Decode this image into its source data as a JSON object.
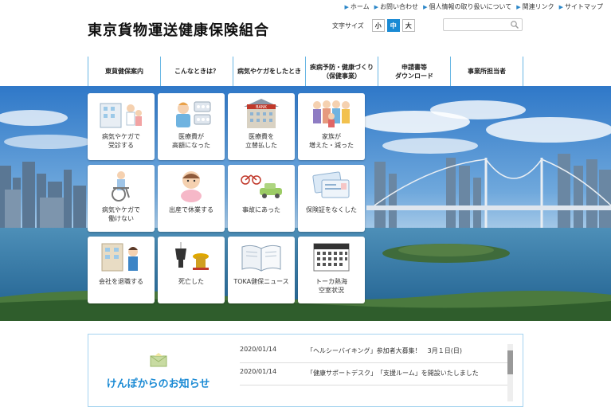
{
  "util_links": [
    {
      "label": "ホーム"
    },
    {
      "label": "お問い合わせ"
    },
    {
      "label": "個人情報の取り扱いについて"
    },
    {
      "label": "関連リンク"
    },
    {
      "label": "サイトマップ"
    }
  ],
  "site_title": "東京貨物運送健康保険組合",
  "font_size": {
    "label": "文字サイズ",
    "small": "小",
    "medium": "中",
    "large": "大",
    "active": "medium"
  },
  "search": {
    "placeholder": ""
  },
  "nav": [
    {
      "label": "東貨健保案内"
    },
    {
      "label": "こんなときは？"
    },
    {
      "label": "病気やケガをしたとき"
    },
    {
      "label": "疾病予防・健康づくり\n（保健事業）"
    },
    {
      "label": "申請書等\nダウンロード"
    },
    {
      "label": "事業所担当者"
    }
  ],
  "tiles": [
    {
      "label": "病気やケガで\n受診する",
      "icon": "hospital-icon"
    },
    {
      "label": "医療費が\n高額になった",
      "icon": "medicine-icon"
    },
    {
      "label": "医療費を\n立替払した",
      "icon": "bank-icon"
    },
    {
      "label": "家族が\n増えた・減った",
      "icon": "family-icon"
    },
    {
      "label": "病気やケガで\n働けない",
      "icon": "wheelchair-icon"
    },
    {
      "label": "出産で休業する",
      "icon": "baby-icon"
    },
    {
      "label": "事故にあった",
      "icon": "accident-icon"
    },
    {
      "label": "保険証をなくした",
      "icon": "insurance-card-icon"
    },
    {
      "label": "会社を退職する",
      "icon": "retire-icon"
    },
    {
      "label": "死亡した",
      "icon": "incense-icon"
    },
    {
      "label": "TOKA健保ニュース",
      "icon": "book-icon"
    },
    {
      "label": "トーカ熱海\n空室状況",
      "icon": "calendar-icon"
    }
  ],
  "news": {
    "title": "けんぽからのお知らせ",
    "items": [
      {
        "date": "2020/01/14",
        "text": "「ヘルシーバイキング」参加者大募集！　3月１日(日)"
      },
      {
        "date": "2020/01/14",
        "text": "「健康サポートデスク」　「支援ルーム」を開設いたしました"
      }
    ]
  },
  "colors": {
    "accent": "#1a8ad4",
    "nav_divider": "#6ab7e4"
  }
}
